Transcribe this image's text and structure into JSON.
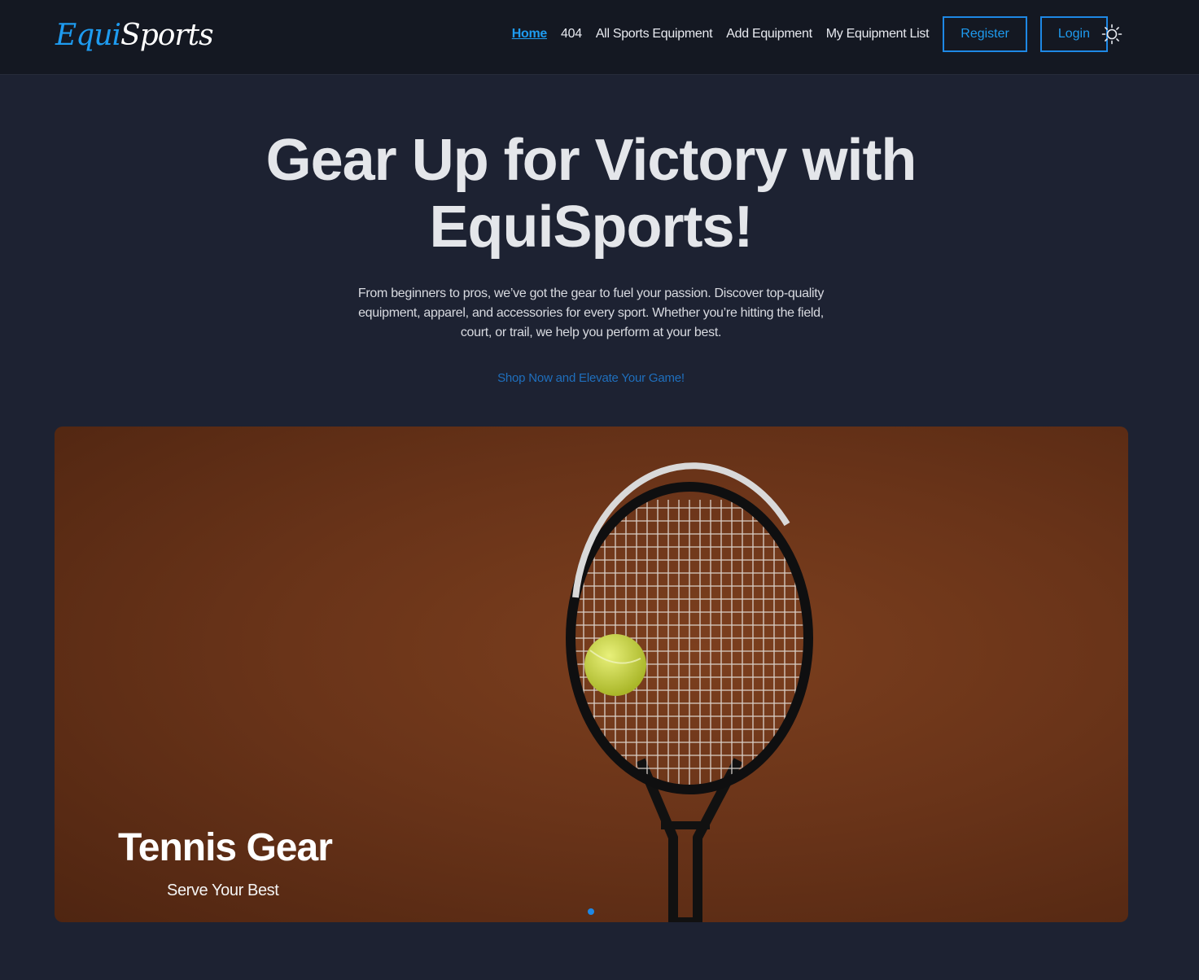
{
  "brand": {
    "part1": "Equi",
    "part2": "Sports"
  },
  "nav": {
    "links": [
      {
        "label": "Home",
        "active": true
      },
      {
        "label": "404"
      },
      {
        "label": "All Sports Equipment"
      },
      {
        "label": "Add Equipment"
      },
      {
        "label": "My Equipment List"
      }
    ],
    "register_label": "Register",
    "login_label": "Login",
    "theme_icon": "sun-icon"
  },
  "hero": {
    "title": "Gear Up for Victory with EquiSports!",
    "description": "From beginners to pros, we’ve got the gear to fuel your passion. Discover top-quality equipment, apparel, and accessories for every sport. Whether you’re hitting the field, court, or trail, we help you perform at your best.",
    "cta": "Shop Now and Elevate Your Game!"
  },
  "carousel": {
    "slide_title": "Tennis Gear",
    "slide_subtitle": "Serve Your Best",
    "dot_count": 1,
    "active_index": 0
  },
  "colors": {
    "accent": "#1e9bf0",
    "page_bg": "#1d2232",
    "nav_bg": "#141822",
    "clay": "#6a3419"
  }
}
